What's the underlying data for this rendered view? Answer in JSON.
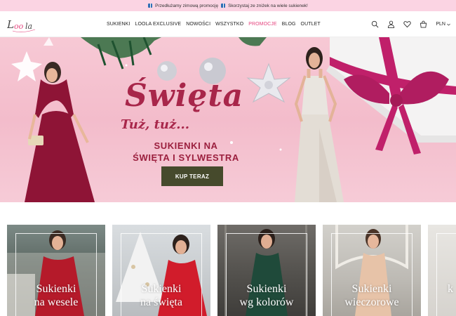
{
  "promo": {
    "text1": "Przedłużamy zimową promocję",
    "text2": "Skorzystaj ze zniżek na wiele sukienek!"
  },
  "header": {
    "logo_text": "Loola",
    "nav": [
      {
        "label": "SUKIENKI"
      },
      {
        "label": "LOOLA EXCLUSIVE"
      },
      {
        "label": "NOWOŚCI"
      },
      {
        "label": "WSZYSTKO"
      },
      {
        "label": "PROMOCJE"
      },
      {
        "label": "BLOG"
      },
      {
        "label": "OUTLET"
      }
    ],
    "currency": "PLN"
  },
  "hero": {
    "title": "Święta",
    "subtitle": "Tuż, tuż...",
    "text_line1": "SUKIENKI NA",
    "text_line2": "ŚWIĘTA I SYLWESTRA",
    "cta": "KUP TERAZ"
  },
  "categories": [
    {
      "line1": "Sukienki",
      "line2": "na wesele"
    },
    {
      "line1": "Sukienki",
      "line2": "na święta"
    },
    {
      "line1": "Sukienki",
      "line2": "wg kolorów"
    },
    {
      "line1": "Sukienki",
      "line2": "wieczorowe"
    },
    {
      "line1": "",
      "line2": "k"
    }
  ],
  "colors": {
    "accent_pink": "#e5447e",
    "promo_bg": "#fbd4e3",
    "cta_bg": "#464a2c",
    "hero_title": "#a8264a"
  },
  "icons": [
    "search-icon",
    "user-icon",
    "heart-icon",
    "cart-icon",
    "chevron-down-icon",
    "gift-icon"
  ]
}
